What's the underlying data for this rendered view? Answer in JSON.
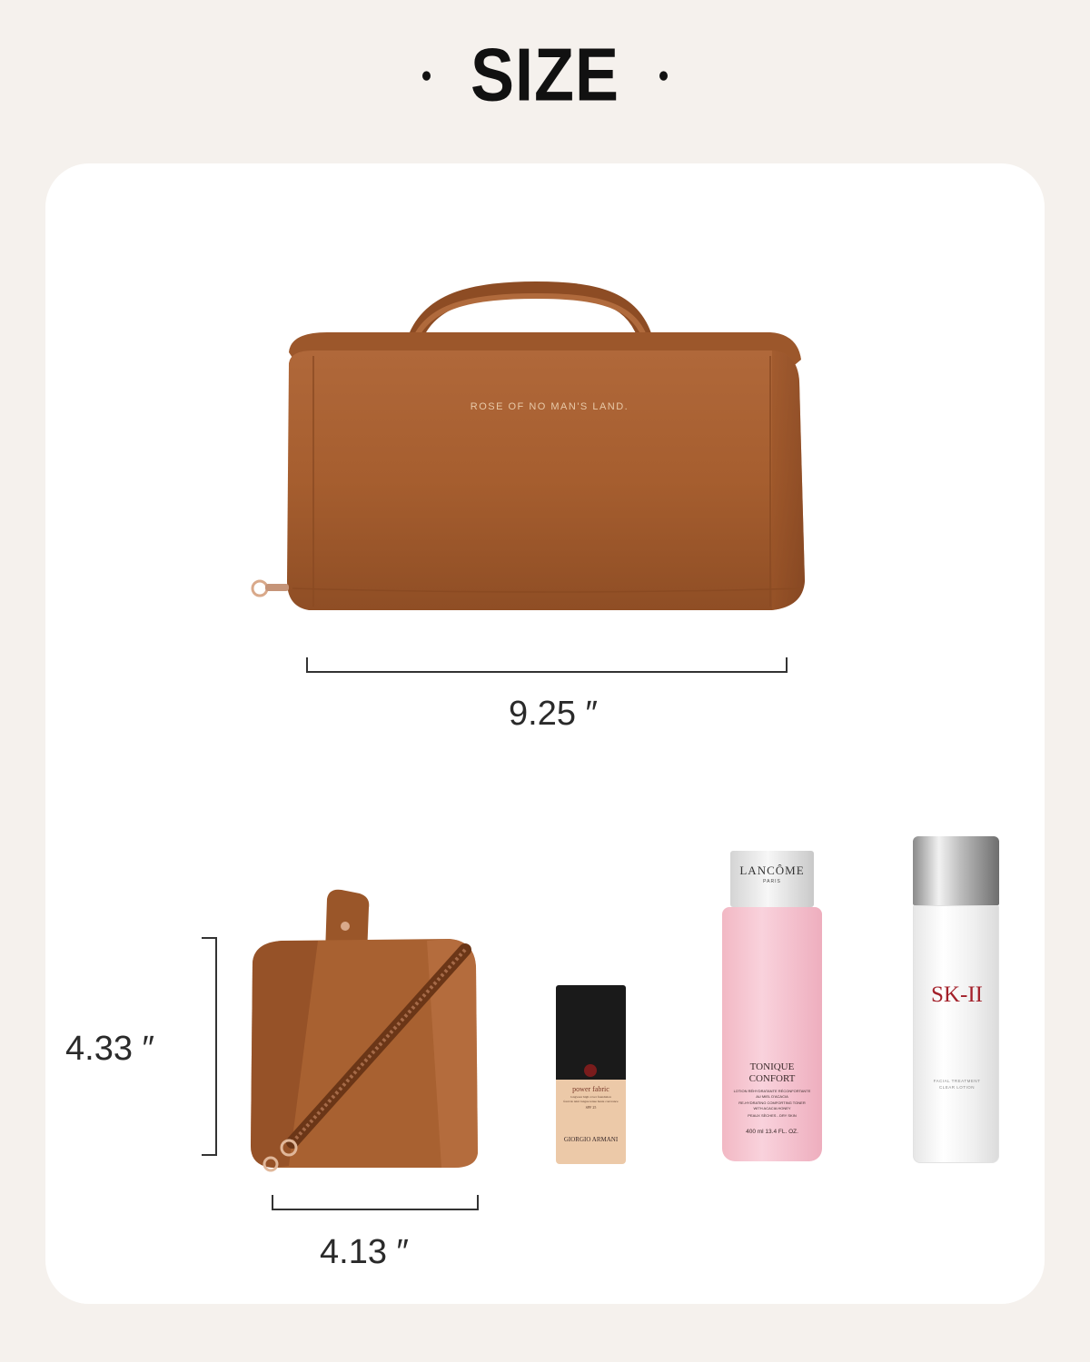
{
  "title": "SIZE",
  "bag_top": {
    "brand_text": "ROSE OF NO MAN'S LAND.",
    "width_label": "9.25 ″"
  },
  "bag_side": {
    "height_label": "4.33 ″",
    "depth_label": "4.13 ″"
  },
  "products": {
    "foundation": {
      "line1": "power fabric",
      "line2": "longwear high cover foundation",
      "line3": "fond de teint longue tenue haute couvrance",
      "line4": "SPF 25",
      "brand": "GIORGIO ARMANI"
    },
    "toner": {
      "brand": "LANCÔME",
      "sub": "PARIS",
      "name1": "TONIQUE",
      "name2": "CONFORT",
      "desc1": "LOTION RÉHYDRATANTE RÉCONFORTANTE",
      "desc2": "AU MIEL D'ACACIA",
      "desc3": "RE-HYDRATING COMFORTING TONER",
      "desc4": "WITH ACACIA HONEY",
      "desc5": "PEAUX SÈCHES - DRY SKIN",
      "volume": "400 ml  13.4 FL. OZ."
    },
    "essence": {
      "brand": "SK-II",
      "line1": "FACIAL TREATMENT",
      "line2": "CLEAR LOTION"
    }
  },
  "colors": {
    "background": "#f5f1ed",
    "card": "#ffffff",
    "leather": "#a8602f",
    "dimension_line": "#333333"
  }
}
